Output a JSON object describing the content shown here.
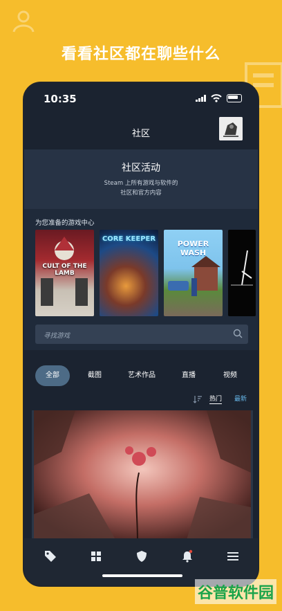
{
  "promo": {
    "headline": "看看社区都在聊些什么"
  },
  "status_bar": {
    "time": "10:35"
  },
  "nav": {
    "title": "社区"
  },
  "activity": {
    "title": "社区活动",
    "line1": "Steam 上所有游戏与软件的",
    "line2": "社区和官方内容"
  },
  "hub": {
    "label": "为您准备的游戏中心",
    "games": [
      {
        "title": "CULT OF THE LAMB",
        "bg": "#c8c0b4"
      },
      {
        "title": "CORE KEEPER",
        "bg": "#1d4a86"
      },
      {
        "title": "POWER WASH",
        "bg": "#7ec3ec"
      },
      {
        "title": "",
        "bg": "#050505"
      }
    ]
  },
  "search": {
    "placeholder": "寻找游戏"
  },
  "filters": {
    "tabs": [
      "全部",
      "截图",
      "艺术作品",
      "直播",
      "视频"
    ],
    "active_index": 0
  },
  "sort": {
    "hot": "热门",
    "new": "最新"
  },
  "watermark": {
    "text": "谷普软件园"
  },
  "colors": {
    "accent": "#66b6e8",
    "background": "#f6bd2c",
    "app": "#1b2330"
  }
}
